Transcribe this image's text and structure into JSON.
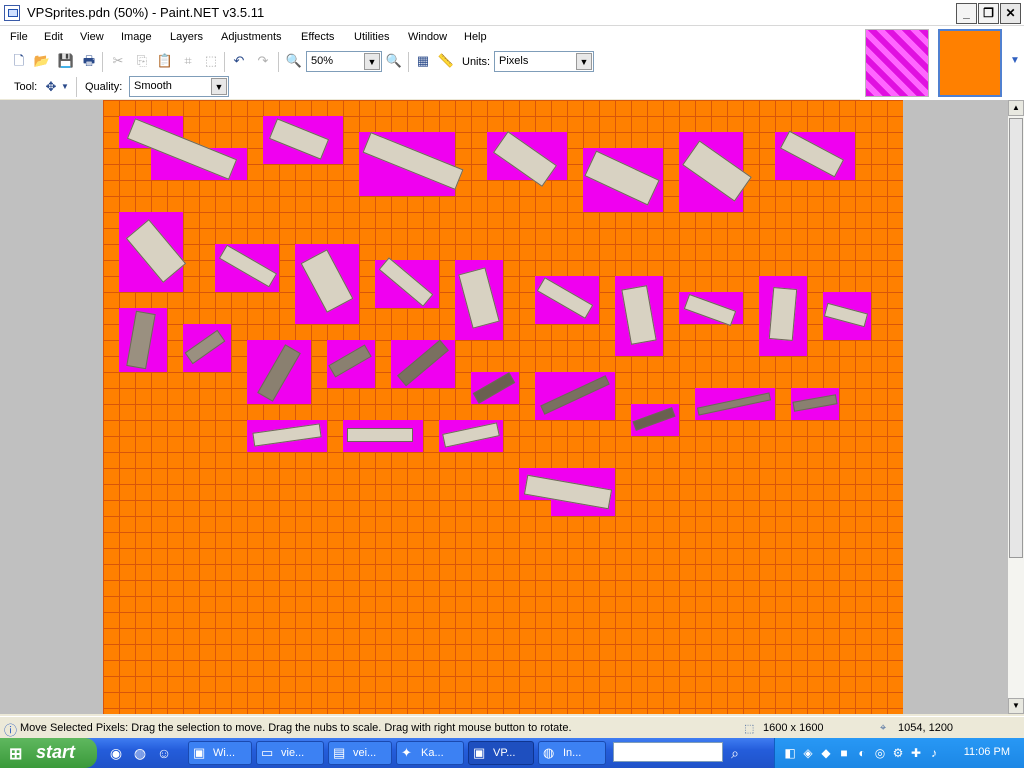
{
  "window": {
    "title": "VPSprites.pdn (50%) - Paint.NET v3.5.11",
    "controls": [
      "_",
      "❐",
      "✕"
    ]
  },
  "menu": [
    "File",
    "Edit",
    "View",
    "Image",
    "Layers",
    "Adjustments",
    "Effects",
    "Utilities",
    "Window",
    "Help"
  ],
  "toolbar": {
    "zoom_value": "50%",
    "units_label": "Units:",
    "units_value": "Pixels"
  },
  "toolsbar": {
    "tool_label": "Tool:",
    "quality_label": "Quality:",
    "quality_value": "Smooth"
  },
  "status": {
    "hint": "Move Selected Pixels: Drag the selection to move. Drag the nubs to scale. Drag with right mouse button to rotate.",
    "image_size": "1600 x 1600",
    "cursor_pos": "1054, 1200"
  },
  "taskbar": {
    "start_label": "start",
    "tasks": [
      "Wi...",
      "vie...",
      "vei...",
      "Ka...",
      "VP...",
      "In..."
    ],
    "clock": "11:06 PM"
  },
  "colors": {
    "canvas": "#ff8000",
    "grid": "#d8560a",
    "sprite_bg": "#f000f0",
    "sprite_part": "#d8d2c2"
  }
}
